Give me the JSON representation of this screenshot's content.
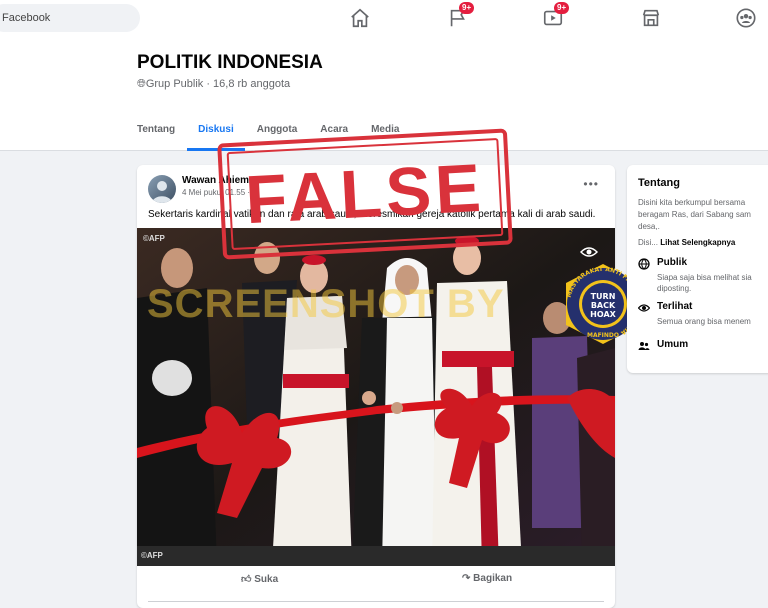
{
  "topbar": {
    "search_text": "Facebook",
    "nav": [
      {
        "icon": "home-icon",
        "badge": ""
      },
      {
        "icon": "flag-icon",
        "badge": "9+"
      },
      {
        "icon": "video-icon",
        "badge": "9+"
      },
      {
        "icon": "marketplace-icon",
        "badge": ""
      },
      {
        "icon": "groups-icon",
        "badge": ""
      }
    ]
  },
  "group": {
    "title": "POLITIK INDONESIA",
    "subtitle": "Grup Publik · 16,8 rb anggota",
    "tabs": [
      "Tentang",
      "Diskusi",
      "Anggota",
      "Acara",
      "Media"
    ],
    "active_tab": "Diskusi"
  },
  "post": {
    "author": "Wawan Ahiemza",
    "time": "4 Mei pukul 01.55 ·",
    "text": "Sekertaris kardinal vatikan dan raja arab saudi, meresmikan gereja katolik pertama kali di arab saudi.",
    "photo": {
      "credit_top": "©AFP",
      "credit_bottom": "©AFP",
      "watermark": "SCREENSHOT BY"
    },
    "actions": {
      "like": "Suka",
      "share": "Bagikan"
    }
  },
  "stamp": {
    "verdict": "FALSE",
    "color": "#d9323b"
  },
  "logo": {
    "ring_text": "MASYARAKAT ANTI FITNAH INDONESIA",
    "center_line1": "TURN",
    "center_line2": "BACK",
    "center_line3": "HOAX",
    "bottom_text": "MAFINDO"
  },
  "sidebar": {
    "title": "Tentang",
    "desc_lines": [
      "Disini kita berkumpul bersama",
      "beragam Ras, dari Sabang sam",
      "desa,."
    ],
    "desc_more_prefix": "Disi... ",
    "see_more": "Lihat Selengkapnya",
    "public_title": "Publik",
    "public_desc_1": "Siapa saja bisa melihat sia",
    "public_desc_2": "diposting.",
    "visible_title": "Terlihat",
    "visible_desc": "Semua orang bisa menem",
    "general_title": "Umum"
  },
  "colors": {
    "accent": "#1877f2",
    "badge": "#e41e3f",
    "ribbon": "#d8141c"
  }
}
